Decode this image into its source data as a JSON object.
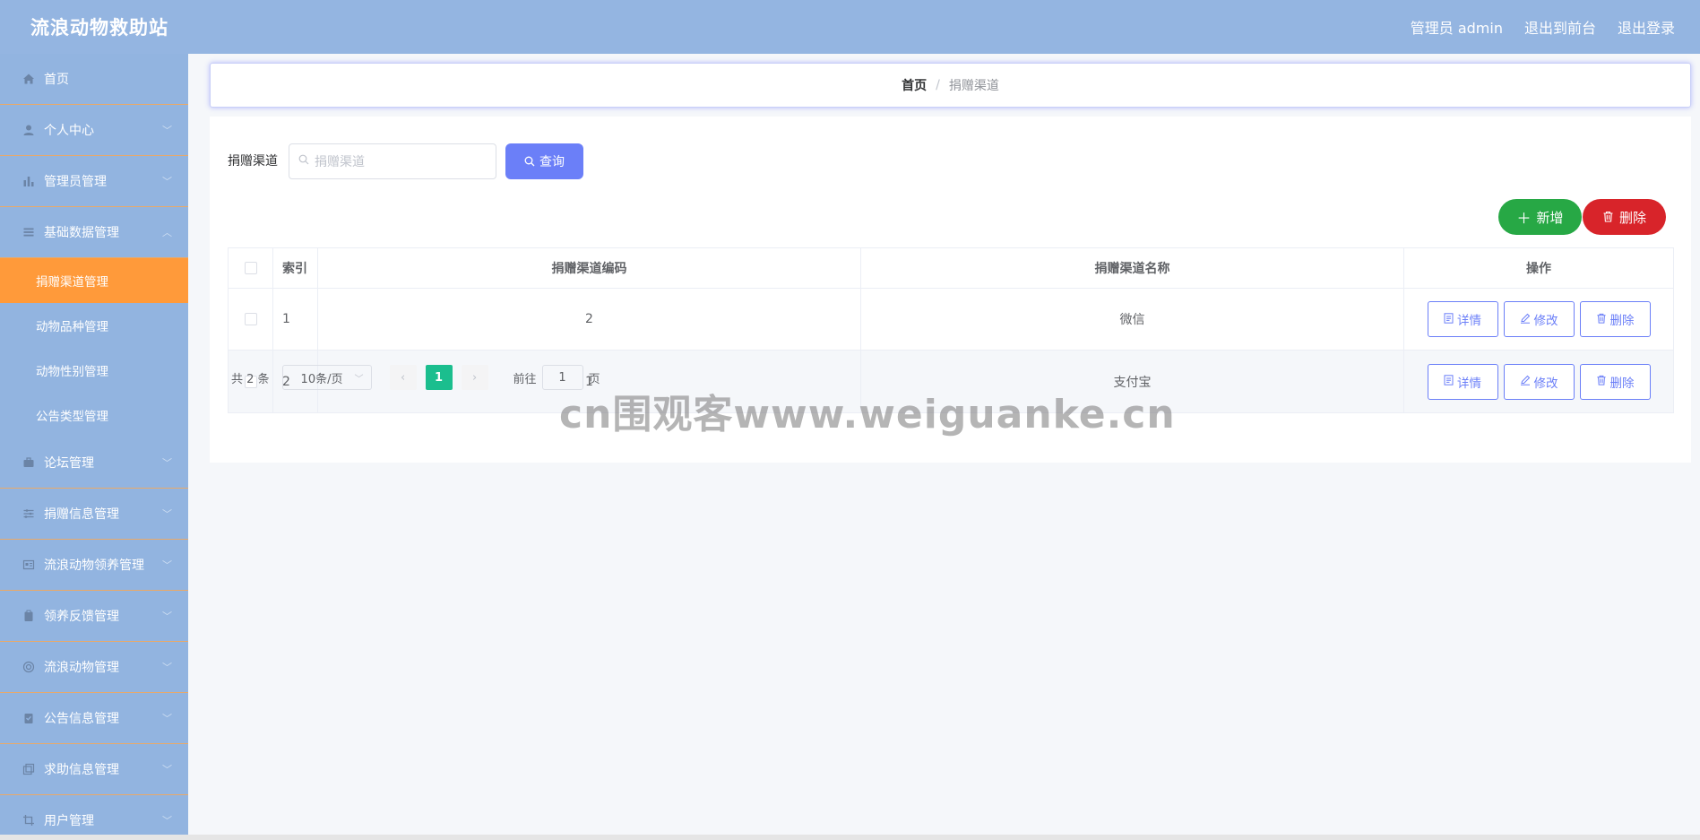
{
  "header": {
    "app_title": "流浪动物救助站",
    "admin_label": "管理员 admin",
    "exit_front_label": "退出到前台",
    "logout_label": "退出登录"
  },
  "sidebar": {
    "items": [
      {
        "label": "首页",
        "icon": "home-icon",
        "chevron": false
      },
      {
        "label": "个人中心",
        "icon": "user-icon",
        "chevron": true
      },
      {
        "label": "管理员管理",
        "icon": "bar-chart-icon",
        "chevron": true
      },
      {
        "label": "基础数据管理",
        "icon": "list-icon",
        "chevron": true
      }
    ],
    "sub_items": [
      {
        "label": "捐赠渠道管理",
        "active": true
      },
      {
        "label": "动物品种管理",
        "active": false
      },
      {
        "label": "动物性别管理",
        "active": false
      },
      {
        "label": "公告类型管理",
        "active": false
      }
    ],
    "items_after": [
      {
        "label": "论坛管理",
        "icon": "briefcase-icon"
      },
      {
        "label": "捐赠信息管理",
        "icon": "sliders-icon"
      },
      {
        "label": "流浪动物领养管理",
        "icon": "id-card-icon"
      },
      {
        "label": "领养反馈管理",
        "icon": "clipboard-icon"
      },
      {
        "label": "流浪动物管理",
        "icon": "circle-icon"
      },
      {
        "label": "公告信息管理",
        "icon": "checklist-icon"
      },
      {
        "label": "求助信息管理",
        "icon": "copy-icon"
      },
      {
        "label": "用户管理",
        "icon": "crop-icon"
      }
    ]
  },
  "breadcrumb": {
    "home": "首页",
    "separator": "/",
    "current": "捐赠渠道"
  },
  "search": {
    "label": "捐赠渠道",
    "placeholder": "捐赠渠道",
    "query_label": "查询"
  },
  "actions": {
    "add_label": "新增",
    "delete_label": "删除"
  },
  "table": {
    "headers": {
      "index": "索引",
      "code": "捐赠渠道编码",
      "name": "捐赠渠道名称",
      "ops": "操作"
    },
    "rows": [
      {
        "index": "1",
        "code": "2",
        "name": "微信"
      },
      {
        "index": "2",
        "code": "1",
        "name": "支付宝"
      }
    ],
    "op_labels": {
      "detail": "详情",
      "edit": "修改",
      "delete": "删除"
    }
  },
  "pagination": {
    "total": "共 2 条",
    "page_size": "10条/页",
    "current_page": "1",
    "goto_prefix": "前往",
    "goto_value": "1",
    "goto_suffix": "页"
  },
  "watermark": "cn围观客www.weiguanke.cn",
  "colors": {
    "header_bg": "#94b5e1",
    "sidebar_bg": "#92b4e0",
    "active_item": "#ff9a3a",
    "primary": "#6b7ff8",
    "success": "#27a845",
    "danger": "#d8242a",
    "pager_current": "#1bbe8e"
  }
}
